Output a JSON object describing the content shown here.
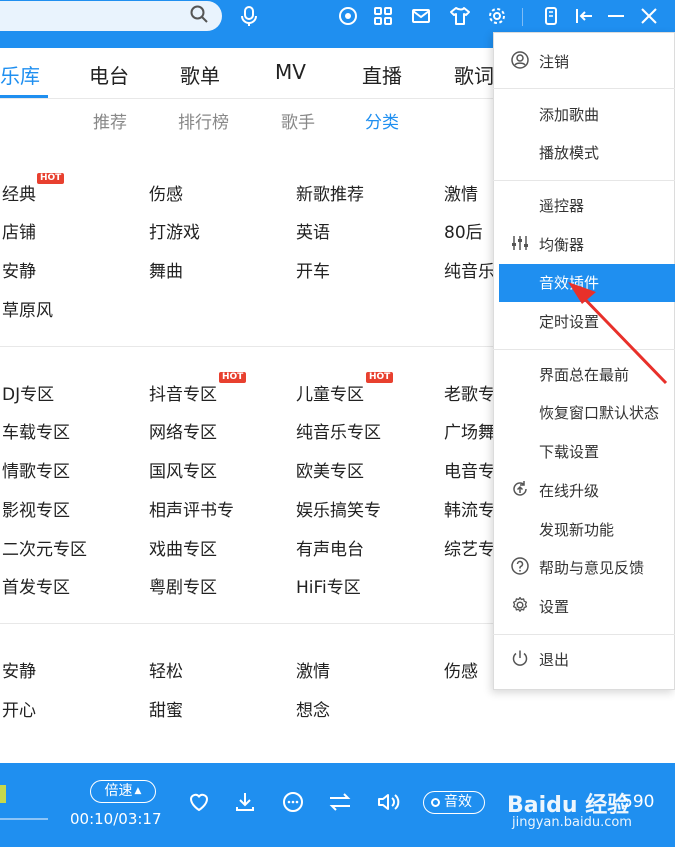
{
  "colors": {
    "accent": "#1f8ff0",
    "hot_badge": "#e8402f",
    "arrow": "#e8302a"
  },
  "topbar": {
    "icons": [
      "search-icon",
      "voice-icon",
      "play-circle-icon",
      "grid-icon",
      "mail-icon",
      "skin-icon",
      "gear-icon",
      "phone-icon",
      "mini-mode-icon",
      "minimize-icon",
      "close-icon"
    ]
  },
  "tabs": [
    "乐库",
    "电台",
    "歌单",
    "MV",
    "直播",
    "歌词"
  ],
  "subtabs": [
    "推荐",
    "排行榜",
    "歌手",
    "分类"
  ],
  "hot_label": "HOT",
  "section1": [
    [
      "经典",
      "伤感",
      "新歌推荐",
      "激情"
    ],
    [
      "店铺",
      "打游戏",
      "英语",
      "80后"
    ],
    [
      "安静",
      "舞曲",
      "开车",
      "纯音乐"
    ],
    [
      "草原风"
    ]
  ],
  "section2": [
    [
      "DJ专区",
      "抖音专区",
      "儿童专区",
      "老歌专"
    ],
    [
      "车载专区",
      "网络专区",
      "纯音乐专区",
      "广场舞"
    ],
    [
      "情歌专区",
      "国风专区",
      "欧美专区",
      "电音专"
    ],
    [
      "影视专区",
      "相声评书专",
      "娱乐搞笑专",
      "韩流专"
    ],
    [
      "二次元专区",
      "戏曲专区",
      "有声电台",
      "综艺专"
    ],
    [
      "首发专区",
      "粤剧专区",
      "HiFi专区"
    ]
  ],
  "section3": [
    [
      "安静",
      "轻松",
      "激情",
      "伤感"
    ],
    [
      "开心",
      "甜蜜",
      "想念"
    ]
  ],
  "menu": {
    "logout": "注销",
    "add_song": "添加歌曲",
    "play_mode": "播放模式",
    "remote": "遥控器",
    "equalizer": "均衡器",
    "effect_plugin": "音效插件",
    "timer": "定时设置",
    "always_top": "界面总在最前",
    "restore_window": "恢复窗口默认状态",
    "download_settings": "下载设置",
    "online_upgrade": "在线升级",
    "new_features": "发现新功能",
    "help_feedback": "帮助与意见反馈",
    "settings": "设置",
    "exit": "退出"
  },
  "player": {
    "speed": "倍速",
    "time": "00:10/03:17",
    "effect": "音效",
    "count": "590",
    "watermark": "Baidu 经验",
    "watermark_sub": "jingyan.baidu.com"
  }
}
